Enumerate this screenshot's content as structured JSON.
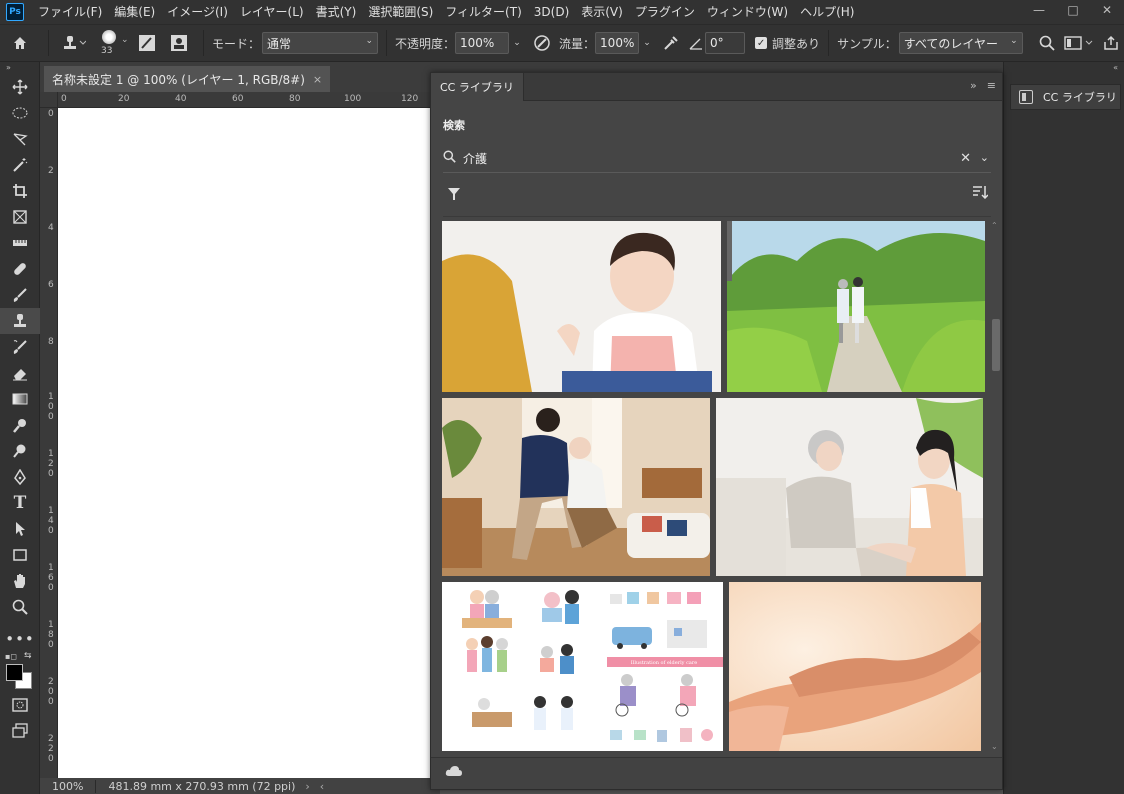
{
  "app": {
    "logo": "Ps"
  },
  "menu": [
    "ファイル(F)",
    "編集(E)",
    "イメージ(I)",
    "レイヤー(L)",
    "書式(Y)",
    "選択範囲(S)",
    "フィルター(T)",
    "3D(D)",
    "表示(V)",
    "プラグイン",
    "ウィンドウ(W)",
    "ヘルプ(H)"
  ],
  "window_controls": {
    "minimize": "—",
    "maximize": "□",
    "close": "✕"
  },
  "options": {
    "brush_size": "33",
    "mode_label": "モード：",
    "mode_value": "通常",
    "opacity_label": "不透明度：",
    "opacity_value": "100%",
    "flow_label": "流量：",
    "flow_value": "100%",
    "angle_value": "0°",
    "aligned_label": "調整あり",
    "sample_label": "サンプル：",
    "sample_value": "すべてのレイヤー"
  },
  "document": {
    "tab_title": "名称未設定 1 @ 100% (レイヤー 1, RGB/8#)",
    "tab_close": "×",
    "ruler_h": [
      "0",
      "20",
      "40",
      "60",
      "80",
      "100",
      "120"
    ],
    "ruler_v": [
      "0",
      "2",
      "4",
      "6",
      "8",
      "1 0 0",
      "1 2 0",
      "1 4 0",
      "1 6 0",
      "1 8 0",
      "2 0 0",
      "2 2 0",
      "2 4 0"
    ],
    "zoom": "100%",
    "size_info": "481.89 mm x 270.93 mm (72 ppi)"
  },
  "cc_panel": {
    "tab": "CC ライブラリ",
    "search_label": "検索",
    "search_value": "介護",
    "results": [
      {
        "name": "result-caregiver-smiling",
        "colors": [
          "#e9e6e1",
          "#f4c2a6",
          "#d9a53a"
        ]
      },
      {
        "name": "result-walking-path",
        "colors": [
          "#7ab84a",
          "#cfe8a8",
          "#d8d3c4"
        ]
      },
      {
        "name": "result-helping-elderly-man",
        "colors": [
          "#d8c2a3",
          "#8d6b4b",
          "#f0e6d8"
        ]
      },
      {
        "name": "result-elderly-woman-chat",
        "colors": [
          "#f1efea",
          "#d8d6cf",
          "#f2c7a7"
        ]
      },
      {
        "name": "result-elderly-care-illustration",
        "colors": [
          "#ffffff",
          "#f8b9c7",
          "#8eb4da"
        ]
      },
      {
        "name": "result-holding-hands",
        "colors": [
          "#f6d1b0",
          "#e8a57c",
          "#fbe5d0"
        ]
      }
    ],
    "illustration_caption": "Illustration of elderly care"
  },
  "right_dock": {
    "cc_button": "CC ライブラリ"
  },
  "tools": [
    "move",
    "marquee",
    "lasso",
    "magic-wand",
    "crop",
    "frame",
    "ruler",
    "healing",
    "brush",
    "clone-stamp",
    "history-brush",
    "eraser",
    "gradient",
    "smudge",
    "dodge",
    "pen",
    "type",
    "path-select",
    "rectangle",
    "hand",
    "zoom",
    "more"
  ],
  "colors": {
    "foreground": "#000000",
    "background": "#ffffff"
  }
}
